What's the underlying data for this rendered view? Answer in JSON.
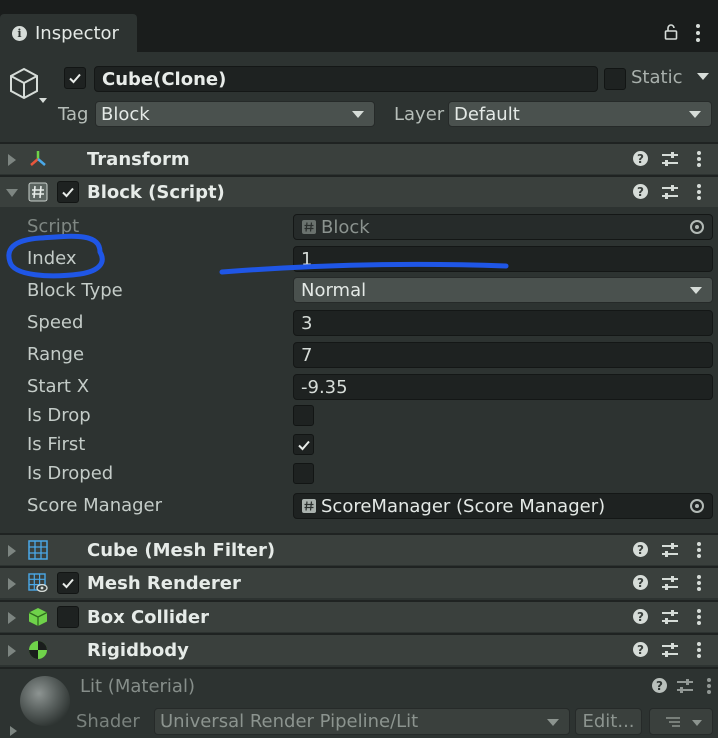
{
  "window": {
    "tab_title": "Inspector"
  },
  "header": {
    "object_name": "Cube(Clone)",
    "active": true,
    "static_label": "Static",
    "static": false,
    "tag_label": "Tag",
    "tag_value": "Block",
    "layer_label": "Layer",
    "layer_value": "Default"
  },
  "components": {
    "transform": {
      "name": "Transform",
      "icon": "transform-icon"
    },
    "block_script": {
      "name": "Block (Script)",
      "icon": "script-icon",
      "enabled": true,
      "properties": {
        "script": {
          "label": "Script",
          "value": "Block"
        },
        "index": {
          "label": "Index",
          "value": "1"
        },
        "block_type": {
          "label": "Block Type",
          "value": "Normal"
        },
        "speed": {
          "label": "Speed",
          "value": "3"
        },
        "range": {
          "label": "Range",
          "value": "7"
        },
        "start_x": {
          "label": "Start X",
          "value": "-9.35"
        },
        "is_drop": {
          "label": "Is Drop",
          "checked": false
        },
        "is_first": {
          "label": "Is First",
          "checked": true
        },
        "is_droped": {
          "label": "Is Droped",
          "checked": false
        },
        "score_manager": {
          "label": "Score Manager",
          "value": "ScoreManager (Score Manager)"
        }
      }
    },
    "mesh_filter": {
      "name": "Cube (Mesh Filter)",
      "icon": "mesh-filter-icon"
    },
    "mesh_renderer": {
      "name": "Mesh Renderer",
      "icon": "mesh-renderer-icon",
      "enabled": true
    },
    "box_collider": {
      "name": "Box Collider",
      "icon": "box-collider-icon",
      "enabled": false
    },
    "rigidbody": {
      "name": "Rigidbody",
      "icon": "rigidbody-icon"
    }
  },
  "material": {
    "name": "Lit (Material)",
    "shader_label": "Shader",
    "shader_value": "Universal Render Pipeline/Lit",
    "edit_label": "Edit..."
  },
  "common": {
    "help_glyph": "?"
  },
  "colors": {
    "annotation": "#1f56e6",
    "transform_accent": "#4aa8e8",
    "collider_green": "#6fd24a"
  }
}
